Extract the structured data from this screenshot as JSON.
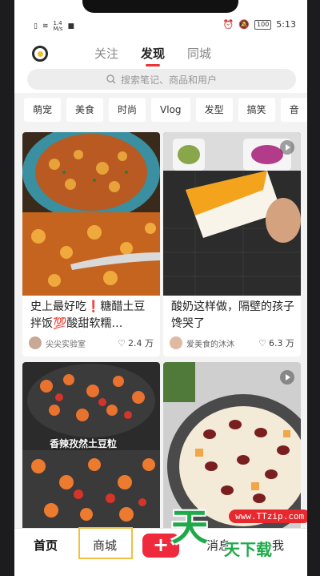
{
  "status": {
    "net_speed": "1.4\nM/s",
    "battery": "100",
    "time": "5:13"
  },
  "tabs": [
    {
      "label": "关注"
    },
    {
      "label": "发现"
    },
    {
      "label": "同城"
    }
  ],
  "search": {
    "placeholder": "搜索笔记、商品和用户"
  },
  "chips": [
    "萌宠",
    "美食",
    "时尚",
    "Vlog",
    "发型",
    "搞笑",
    "音"
  ],
  "feed": [
    {
      "title": "史上最好吃❗糖醋土豆拌饭💯酸甜软糯…",
      "author": "尖尖实验室",
      "likes": "2.4 万",
      "image_caption": ""
    },
    {
      "title": "酸奶这样做，隔壁的孩子馋哭了",
      "author": "爱美食的沐沐",
      "likes": "6.3 万",
      "image_caption": ""
    },
    {
      "title": "",
      "author": "",
      "likes": "",
      "image_caption": "香辣孜然土豆粒"
    },
    {
      "title": "",
      "author": "",
      "likes": "",
      "image_caption": ""
    }
  ],
  "bottom_nav": {
    "home": "首页",
    "shop": "商城",
    "plus": "+",
    "messages": "消息",
    "me": "我"
  },
  "watermark": {
    "url": "www.TTzip.com",
    "big": "天",
    "small": "天下载"
  },
  "colors": {
    "accent_red": "#ee2a3c",
    "tab_underline": "#e33",
    "watermark_green": "#1eaa4a",
    "highlight": "#f0c040"
  }
}
